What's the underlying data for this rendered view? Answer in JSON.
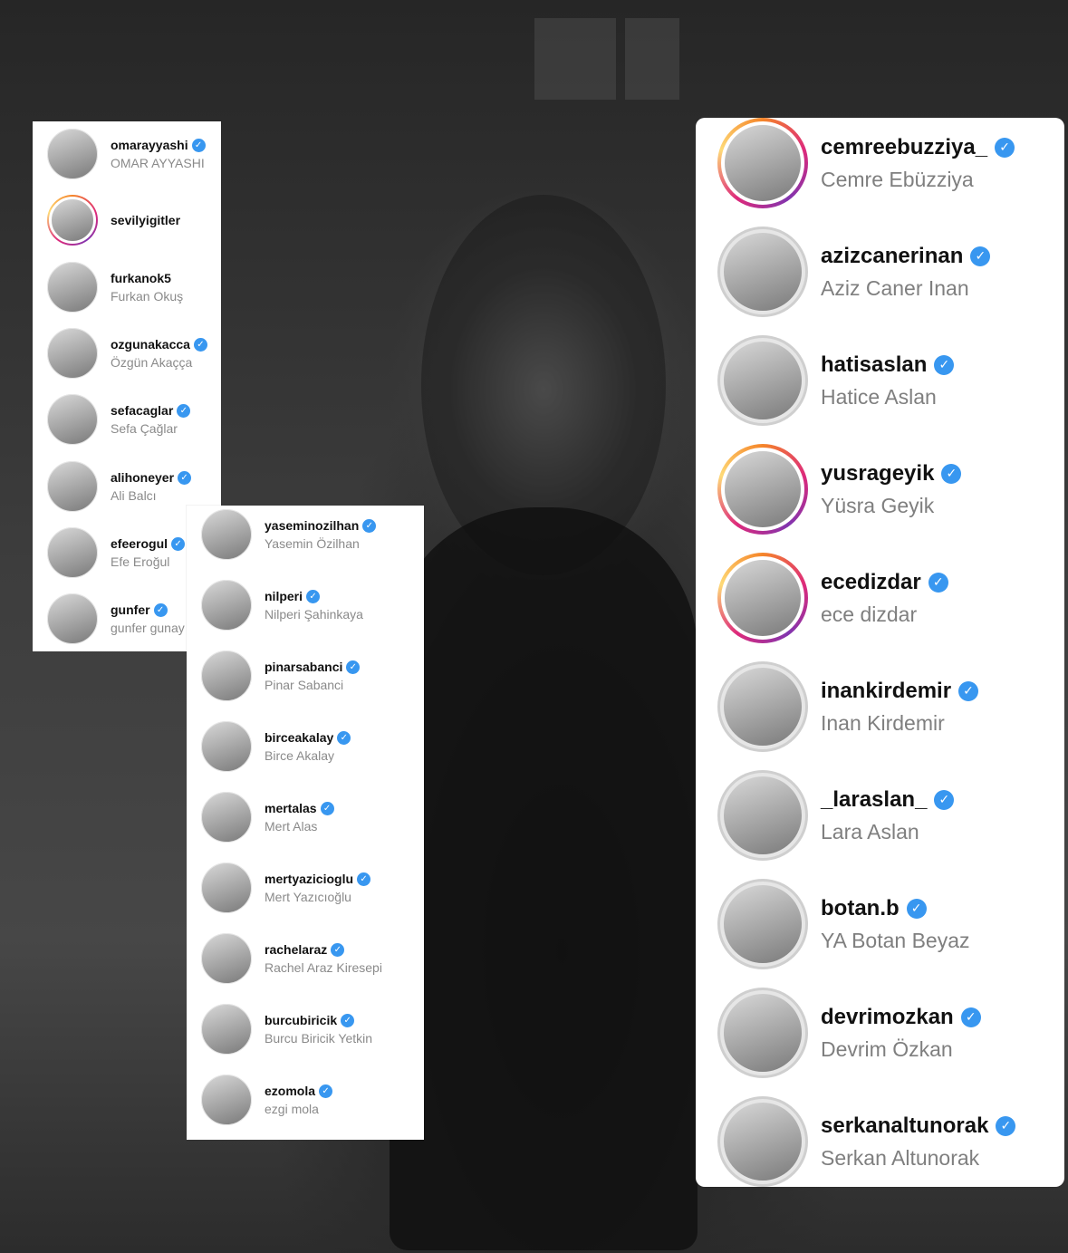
{
  "colors": {
    "verified_badge": "#3897f0",
    "story_ring": "#dd2a7b",
    "panel": "#ffffff"
  },
  "badge_icon": "verified-check-icon",
  "badge_glyph": "✓",
  "left_list": [
    {
      "username": "omarayyashi",
      "name": "OMAR AYYASHI",
      "verified": true,
      "story": false
    },
    {
      "username": "sevilyigitler",
      "name": "",
      "verified": false,
      "story": true
    },
    {
      "username": "furkanok5",
      "name": "Furkan Okuş",
      "verified": false,
      "story": false
    },
    {
      "username": "ozgunakacca",
      "name": "Özgün Akaçça",
      "verified": true,
      "story": false
    },
    {
      "username": "sefacaglar",
      "name": "Sefa Çağlar",
      "verified": true,
      "story": false
    },
    {
      "username": "alihoneyer",
      "name": "Ali Balcı",
      "verified": true,
      "story": false
    },
    {
      "username": "efeerogul",
      "name": "Efe Eroğul",
      "verified": true,
      "story": false
    },
    {
      "username": "gunfer",
      "name": "gunfer gunay",
      "verified": true,
      "story": false
    }
  ],
  "middle_list": [
    {
      "username": "yaseminozilhan",
      "name": "Yasemin Özilhan",
      "verified": true,
      "story": false
    },
    {
      "username": "nilperi",
      "name": "Nilperi Şahinkaya",
      "verified": true,
      "story": false
    },
    {
      "username": "pinarsabanci",
      "name": "Pinar Sabanci",
      "verified": true,
      "story": false
    },
    {
      "username": "birceakalay",
      "name": "Birce Akalay",
      "verified": true,
      "story": false
    },
    {
      "username": "mertalas",
      "name": "Mert Alas",
      "verified": true,
      "story": false
    },
    {
      "username": "mertyazicioglu",
      "name": "Mert Yazıcıoğlu",
      "verified": true,
      "story": false
    },
    {
      "username": "rachelaraz",
      "name": "Rachel Araz Kiresepi",
      "verified": true,
      "story": false
    },
    {
      "username": "burcubiricik",
      "name": "Burcu Biricik Yetkin",
      "verified": true,
      "story": false
    },
    {
      "username": "ezomola",
      "name": "ezgi mola",
      "verified": true,
      "story": false
    }
  ],
  "right_list": [
    {
      "username": "cemreebuzziya_",
      "name": "Cemre Ebüzziya",
      "verified": true,
      "story": true
    },
    {
      "username": "azizcanerinan",
      "name": "Aziz Caner Inan",
      "verified": true,
      "story": false
    },
    {
      "username": "hatisaslan",
      "name": "Hatice Aslan",
      "verified": true,
      "story": false
    },
    {
      "username": "yusrageyik",
      "name": "Yüsra Geyik",
      "verified": true,
      "story": true
    },
    {
      "username": "ecedizdar",
      "name": "ece dizdar",
      "verified": true,
      "story": true
    },
    {
      "username": "inankirdemir",
      "name": "Inan Kirdemir",
      "verified": true,
      "story": false
    },
    {
      "username": "_laraslan_",
      "name": "Lara Aslan",
      "verified": true,
      "story": false
    },
    {
      "username": "botan.b",
      "name": "YA Botan Beyaz",
      "verified": true,
      "story": false
    },
    {
      "username": "devrimozkan",
      "name": "Devrim Özkan",
      "verified": true,
      "story": false
    },
    {
      "username": "serkanaltunorak",
      "name": "Serkan Altunorak",
      "verified": true,
      "story": false
    }
  ]
}
